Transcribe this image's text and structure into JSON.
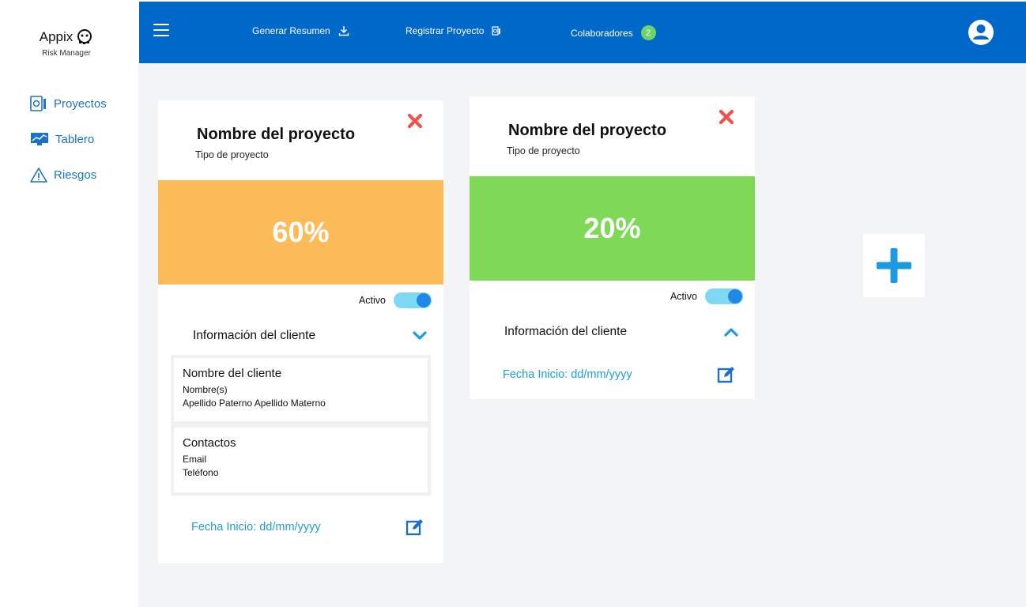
{
  "app": {
    "logo_text": "Appix",
    "logo_subtitle": "Risk Manager"
  },
  "sidebar": {
    "items": [
      {
        "label": "Proyectos",
        "icon": "projects-icon"
      },
      {
        "label": "Tablero",
        "icon": "dashboard-icon"
      },
      {
        "label": "Riesgos",
        "icon": "warning-icon"
      }
    ]
  },
  "header": {
    "generate_summary": "Generar Resumen",
    "register_project": "Registrar Proyecto",
    "collaborators": "Colaboradores",
    "collaborators_count": "2"
  },
  "projects": [
    {
      "title": "Nombre del proyecto",
      "type": "Tipo de proyecto",
      "progress_label": "60%",
      "progress_percent": 60,
      "status_color": "#fdbc5a",
      "active_label": "Activo",
      "active": true,
      "info_label": "Información del cliente",
      "expanded": true,
      "client": {
        "heading": "Nombre del cliente",
        "names": "Nombre(s)",
        "surnames": "Apellido Paterno Apellido Materno"
      },
      "contacts": {
        "heading": "Contactos",
        "email": "Email",
        "phone": "Teléfono"
      },
      "start_date": "Fecha Inicio: dd/mm/yyyy"
    },
    {
      "title": "Nombre del proyecto",
      "type": "Tipo de proyecto",
      "progress_label": "20%",
      "progress_percent": 20,
      "status_color": "#7ed957",
      "active_label": "Activo",
      "active": true,
      "info_label": "Información del cliente",
      "expanded": false,
      "start_date": "Fecha Inicio: dd/mm/yyyy"
    }
  ],
  "colors": {
    "header_bg": "#0068c8",
    "accent_blue": "#1e9be0",
    "close_red": "#f05050",
    "badge_green": "#6fd36a",
    "add_blue": "#1e9be0"
  }
}
